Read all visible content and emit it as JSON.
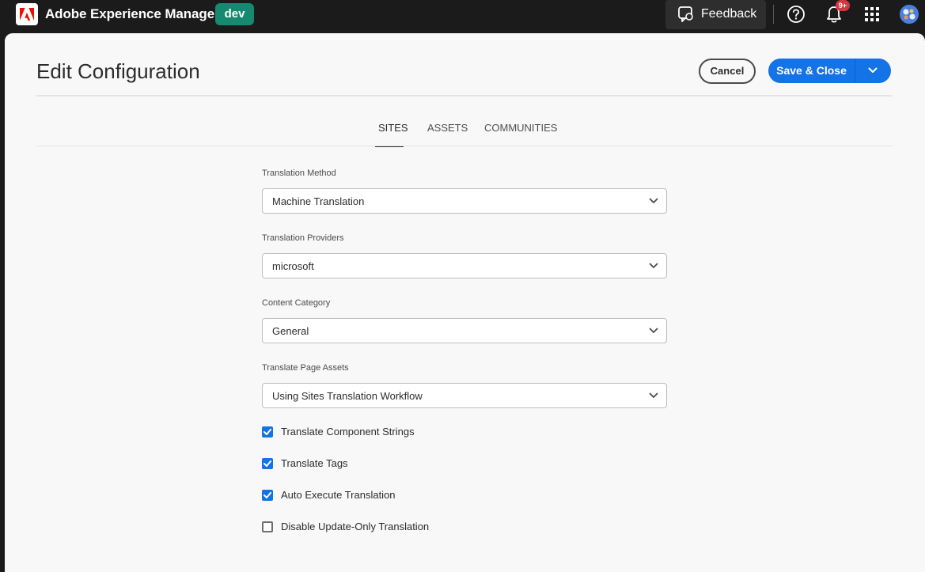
{
  "topbar": {
    "app_title": "Adobe Experience Manager",
    "env_badge": "dev",
    "feedback_label": "Feedback",
    "notification_count": "9+"
  },
  "header": {
    "title": "Edit Configuration",
    "cancel_label": "Cancel",
    "save_label": "Save & Close"
  },
  "tabs": [
    {
      "label": "SITES",
      "active": true
    },
    {
      "label": "ASSETS",
      "active": false
    },
    {
      "label": "COMMUNITIES",
      "active": false
    }
  ],
  "form": {
    "fields": [
      {
        "label": "Translation Method",
        "value": "Machine Translation"
      },
      {
        "label": "Translation Providers",
        "value": "microsoft"
      },
      {
        "label": "Content Category",
        "value": "General"
      },
      {
        "label": "Translate Page Assets",
        "value": "Using Sites Translation Workflow"
      }
    ],
    "checkboxes": [
      {
        "label": "Translate Component Strings",
        "checked": true
      },
      {
        "label": "Translate Tags",
        "checked": true
      },
      {
        "label": "Auto Execute Translation",
        "checked": true
      },
      {
        "label": "Disable Update-Only Translation",
        "checked": false
      }
    ]
  },
  "colors": {
    "accent": "#1473e6",
    "env_badge": "#168a70",
    "notification": "#d7373f"
  }
}
